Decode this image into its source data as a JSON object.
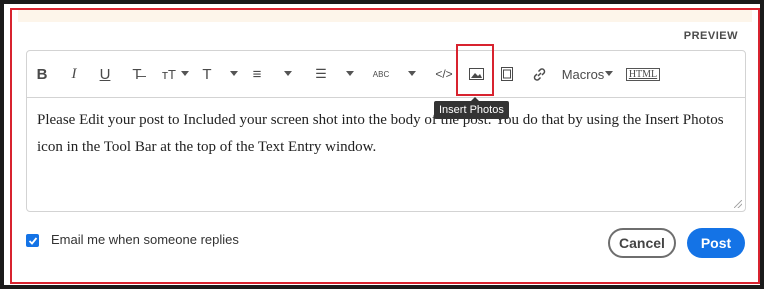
{
  "header": {
    "preview_label": "PREVIEW"
  },
  "toolbar": {
    "items": [
      {
        "name": "bold-button",
        "glyph": "B"
      },
      {
        "name": "italic-button",
        "glyph": "I"
      },
      {
        "name": "underline-button",
        "glyph": "U"
      },
      {
        "name": "strikethrough-button",
        "glyph": "T̶"
      },
      {
        "name": "font-size-button",
        "glyph": "ᴛT"
      },
      {
        "name": "text-color-button",
        "glyph": "T"
      },
      {
        "name": "ordered-list-button",
        "glyph": "≡"
      },
      {
        "name": "bullet-list-button",
        "glyph": "☰"
      },
      {
        "name": "spellcheck-button",
        "glyph": "ABC"
      },
      {
        "name": "code-button",
        "glyph": "</>"
      },
      {
        "name": "insert-photos-button",
        "glyph": ""
      },
      {
        "name": "insert-video-button",
        "glyph": ""
      },
      {
        "name": "insert-link-button",
        "glyph": ""
      }
    ],
    "macros_label": "Macros",
    "html_label": "HTML",
    "tooltip": "Insert Photos"
  },
  "editor": {
    "body": "Please Edit your post to Included your screen shot into the body of the post. You do that by using the Insert Photos icon in the Tool Bar at the top of the Text Entry window."
  },
  "footer": {
    "notify_label": "Email me when someone replies",
    "notify_checked": true,
    "cancel_label": "Cancel",
    "post_label": "Post"
  },
  "colors": {
    "accent": "#1473e6",
    "highlight": "#d8232f"
  }
}
